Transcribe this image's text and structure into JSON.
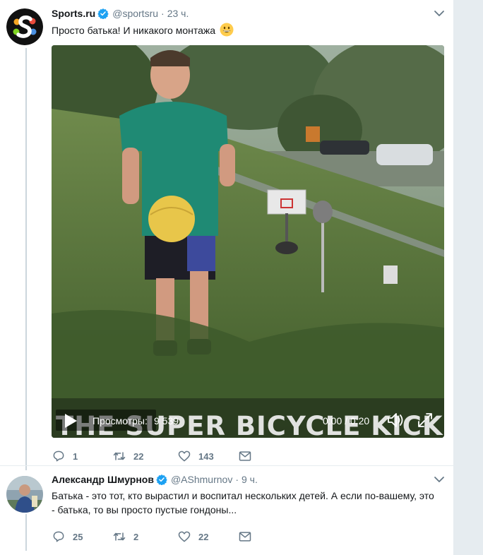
{
  "tweets": [
    {
      "author_name": "Sports.ru",
      "handle": "@sportsru",
      "separator": "·",
      "time": "23 ч.",
      "text": "Просто батька! И никакого монтажа",
      "emoji": "grinning-face-emoji",
      "video": {
        "overlay_text": "THE SUPER BICYCLE KICK",
        "views_label": "Просмотры:",
        "views_count": "9 539",
        "timecode": "0:00 / 0:20"
      },
      "actions": {
        "replies": "1",
        "retweets": "22",
        "likes": "143"
      }
    },
    {
      "author_name": "Александр Шмурнов",
      "handle": "@AShmurnov",
      "separator": "·",
      "time": "9 ч.",
      "text": "Батька - это тот, кто вырастил и воспитал нескольких детей. А если по-вашему, это - батька, то вы просто пустые гондоны...",
      "actions": {
        "replies": "25",
        "retweets": "2",
        "likes": "22"
      }
    }
  ],
  "colors": {
    "verified_blue": "#1da1f2",
    "muted_text": "#657786",
    "thread_line": "#ccd6dd",
    "gutter": "#e6ecf0"
  },
  "icons": [
    "sports-ru-logo",
    "verified-badge-icon",
    "caret-down-icon",
    "play-icon",
    "volume-icon",
    "fullscreen-icon",
    "reply-icon",
    "retweet-icon",
    "like-icon",
    "direct-message-icon"
  ]
}
